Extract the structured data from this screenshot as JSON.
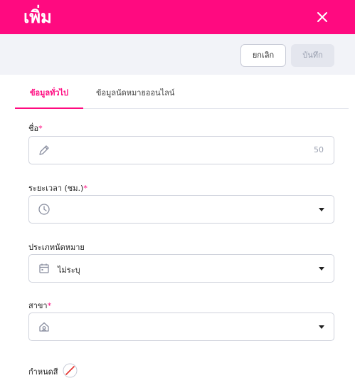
{
  "header": {
    "title": "เพิ่ม",
    "close_icon": "close-icon",
    "color": "#ff0a80"
  },
  "toolbar": {
    "cancel_label": "ยกเลิก",
    "save_label": "บันทึก"
  },
  "tabs": [
    {
      "label": "ข้อมูลทั่วไป",
      "active": true
    },
    {
      "label": "ข้อมูลนัดหมายออนไลน์",
      "active": false
    }
  ],
  "form": {
    "name": {
      "label": "ชื่อ",
      "required_mark": "*",
      "counter": "50",
      "icon": "pencil-icon"
    },
    "duration": {
      "label": "ระยะเวลา (ชม.)",
      "required_mark": "*",
      "icon": "clock-icon"
    },
    "appointment_type": {
      "label": "ประเภทนัดหมาย",
      "value": "ไม่ระบุ",
      "icon": "calendar-icon"
    },
    "branch": {
      "label": "สาขา",
      "required_mark": "*",
      "icon": "branch-icon"
    },
    "color": {
      "label": "กำหนดสี",
      "icon": "no-color-icon"
    }
  }
}
